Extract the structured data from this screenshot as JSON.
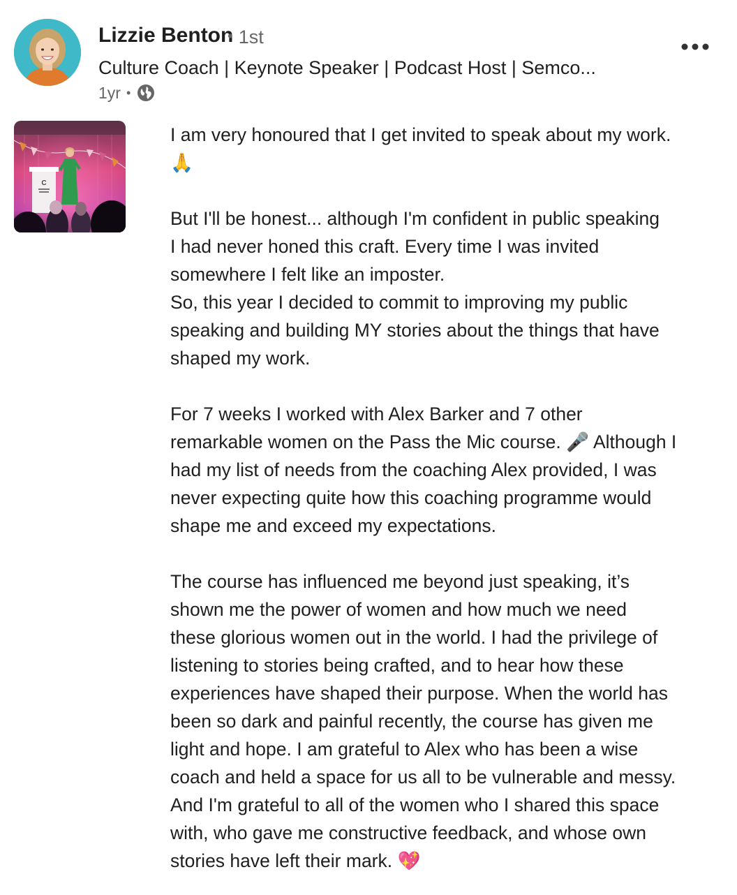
{
  "author": {
    "name": "Lizzie Benton",
    "degree": "1st",
    "headline": "Culture Coach | Keynote Speaker | Podcast Host | Semco...",
    "time_ago": "1yr",
    "avatar_icon": "profile-photo",
    "visibility_icon": "globe-icon"
  },
  "menu": {
    "more_icon": "ellipsis-icon"
  },
  "colors": {
    "avatar_bg": "#3fb8c8",
    "stage_pink": "#d6457a",
    "dress_green": "#2f9b4e"
  },
  "post": {
    "lines": [
      "I am very honoured that I get invited to speak about my work.",
      "🙏",
      "",
      "But I'll be honest... although I'm confident in public speaking",
      "I had never honed this craft. Every time I was invited",
      "somewhere I felt like an imposter.",
      "So, this year I decided to commit to improving my public",
      "speaking and building MY stories about the things that have",
      "shaped my work.",
      "",
      "For 7 weeks I worked with Alex Barker and 7 other",
      "remarkable women on the Pass the Mic course. 🎤 Although I",
      "had my list of needs from the coaching Alex provided, I was",
      "never expecting quite how this coaching programme would",
      "shape me and exceed my expectations.",
      "",
      "The course has influenced me beyond just speaking, it’s",
      "shown me the power of women and how much we need",
      "these glorious women out in the world. I had the privilege of",
      "listening to stories being crafted, and to hear how these",
      "experiences have shaped their purpose. When the world has",
      "been so dark and painful recently, the course has given me",
      "light and hope. I am grateful to Alex who has been a wise",
      "coach and held a space for us all to be vulnerable and messy.",
      "And I'm grateful to all of the women who I shared this space",
      "with, who gave me constructive feedback, and whose own",
      "stories have left their mark. 💖"
    ]
  }
}
